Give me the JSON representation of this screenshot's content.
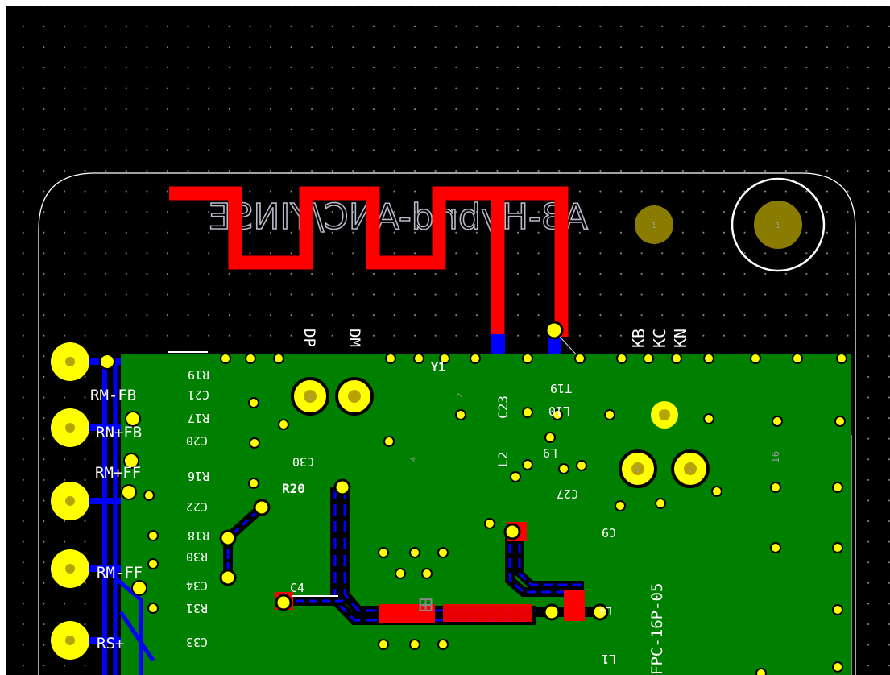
{
  "colors": {
    "background": "#000000",
    "copper_top": "#ff0000",
    "copper_bottom": "#0000ff",
    "pour": "#008000",
    "pad": "#ffff00",
    "via": "#c8b400",
    "silkscreen": "#ffffff",
    "outline": "#ffffff"
  },
  "board_title": "A8-Hybrid-ANC/YINSE",
  "side_labels": [
    "RM-FB",
    "RN+FB",
    "RM+FF",
    "RM-FF",
    "RS+"
  ],
  "net_labels": [
    "KB",
    "KC",
    "KN",
    "DP",
    "DM"
  ],
  "components_normal": [
    "Y1",
    "C23",
    "L2",
    "R20",
    "C4",
    "FPC-16P-05"
  ],
  "components_mirrored": [
    "R19",
    "C21",
    "R17",
    "C20",
    "R16",
    "C22",
    "R18",
    "R30",
    "C34",
    "R31",
    "C33",
    "C30",
    "T19",
    "L10",
    "L9",
    "C27",
    "C9",
    "L1",
    "L4"
  ],
  "pad_numbers": [
    "1",
    "1",
    "1",
    "1",
    "1",
    "2",
    "4",
    "16"
  ]
}
